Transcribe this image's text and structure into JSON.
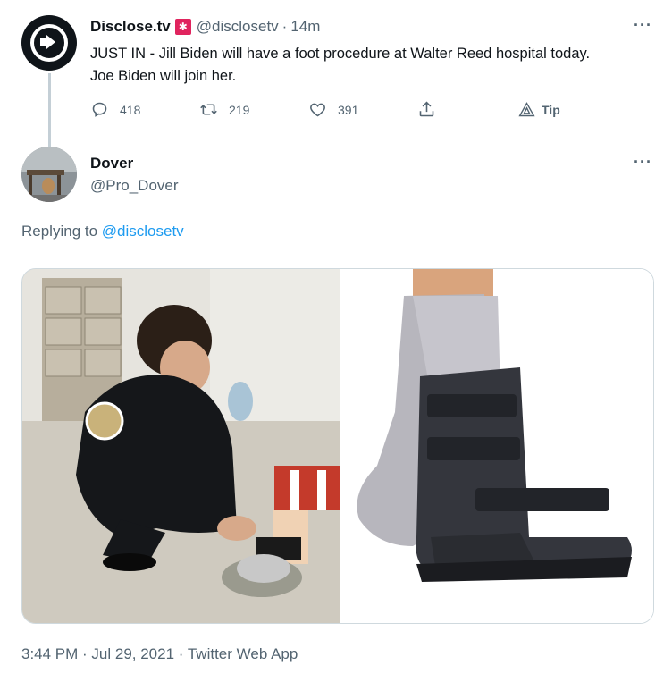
{
  "tweet": {
    "author_name": "Disclose.tv",
    "author_handle": "@disclosetv",
    "time_ago": "14m",
    "separator": "·",
    "text_line1": "JUST IN - Jill Biden will have a foot procedure at Walter Reed hospital today.",
    "text_line2": "Joe Biden will join her.",
    "more": "···",
    "replies": "418",
    "retweets": "219",
    "likes": "391",
    "tip_label": "Tip"
  },
  "reply": {
    "author_name": "Dover",
    "author_handle": "@Pro_Dover",
    "more": "···",
    "replying_prefix": "Replying to ",
    "replying_to": "@disclosetv",
    "timestamp": "3:44 PM · Jul 29, 2021 · Twitter Web App"
  },
  "colors": {
    "accent": "#1d9bf0",
    "muted": "#536471",
    "siren": "#e0245e"
  },
  "icons": [
    "reply-icon",
    "retweet-icon",
    "like-icon",
    "share-icon",
    "tip-icon",
    "siren-emoji"
  ]
}
